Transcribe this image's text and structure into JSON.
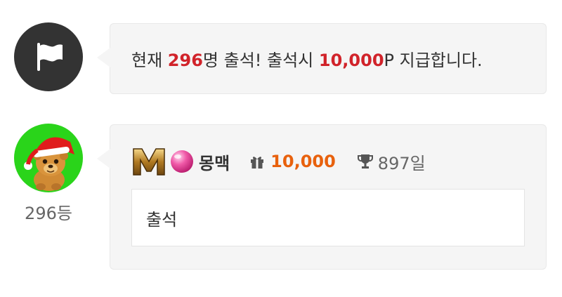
{
  "notice": {
    "prefix": "현재 ",
    "count": "296",
    "middle": "명 출석! 출석시 ",
    "points": "10,000",
    "suffix": "P 지급합니다."
  },
  "entry": {
    "rank": "296등",
    "nickname": "몽맥",
    "gift_points": "10,000",
    "days": "897일",
    "comment": "출석"
  },
  "colors": {
    "highlight_red": "#d1232a",
    "points_orange": "#e8610d",
    "avatar_bg": "#2ad41a"
  }
}
